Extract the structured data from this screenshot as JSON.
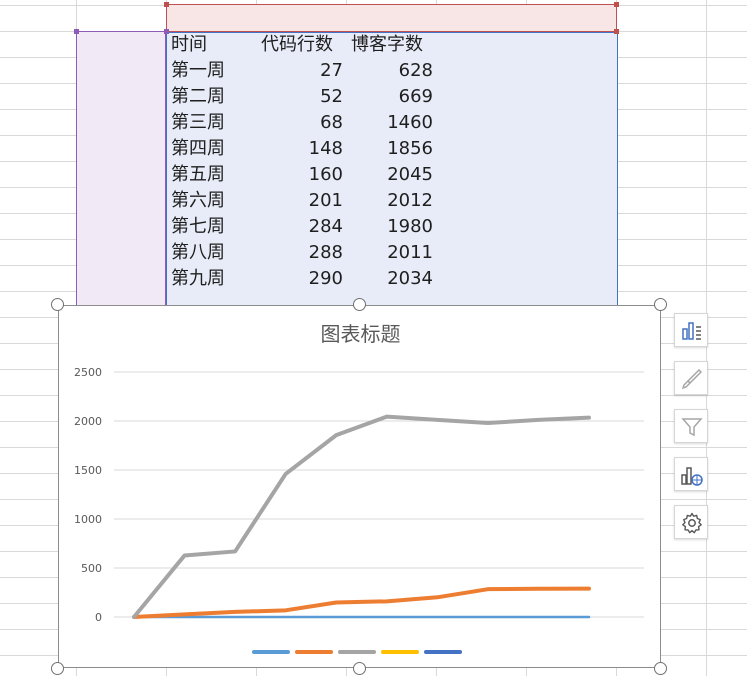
{
  "sheet": {
    "headers": [
      "时间",
      "代码行数",
      "博客字数"
    ],
    "rows": [
      [
        "第一周",
        "27",
        "628"
      ],
      [
        "第二周",
        "52",
        "669"
      ],
      [
        "第三周",
        "68",
        "1460"
      ],
      [
        "第四周",
        "148",
        "1856"
      ],
      [
        "第五周",
        "160",
        "2045"
      ],
      [
        "第六周",
        "201",
        "2012"
      ],
      [
        "第七周",
        "284",
        "1980"
      ],
      [
        "第八周",
        "288",
        "2011"
      ],
      [
        "第九周",
        "290",
        "2034"
      ]
    ]
  },
  "chart_toolbar": {
    "icons": [
      "chart-elements-icon",
      "chart-style-icon",
      "chart-filter-icon",
      "chart-type-icon",
      "chart-settings-icon"
    ]
  },
  "colors": {
    "selection_purple": "#8e5bb6",
    "selection_red": "#c0504d",
    "selection_blue": "#4472c4",
    "series_1": "#5b9bd5",
    "series_2": "#ed7d31",
    "series_3": "#a5a5a5",
    "series_4": "#ffc000",
    "series_5": "#4472c4"
  },
  "chart_data": {
    "type": "line",
    "title": "图表标题",
    "xlabel": "",
    "ylabel": "",
    "categories": [
      "",
      "",
      "",
      "",
      "",
      "",
      "",
      "",
      "",
      ""
    ],
    "ylim": [
      0,
      2500
    ],
    "yticks": [
      0,
      500,
      1000,
      1500,
      2000,
      2500
    ],
    "grid": true,
    "legend": "bottom",
    "series": [
      {
        "color": "#5b9bd5",
        "values": [
          0,
          0,
          0,
          0,
          0,
          0,
          0,
          0,
          0,
          0
        ]
      },
      {
        "color": "#ed7d31",
        "values": [
          0,
          27,
          52,
          68,
          148,
          160,
          201,
          284,
          288,
          290
        ]
      },
      {
        "color": "#a5a5a5",
        "values": [
          0,
          628,
          669,
          1460,
          1856,
          2045,
          2012,
          1980,
          2011,
          2034
        ]
      },
      {
        "color": "#ffc000",
        "values": []
      },
      {
        "color": "#4472c4",
        "values": []
      }
    ]
  }
}
